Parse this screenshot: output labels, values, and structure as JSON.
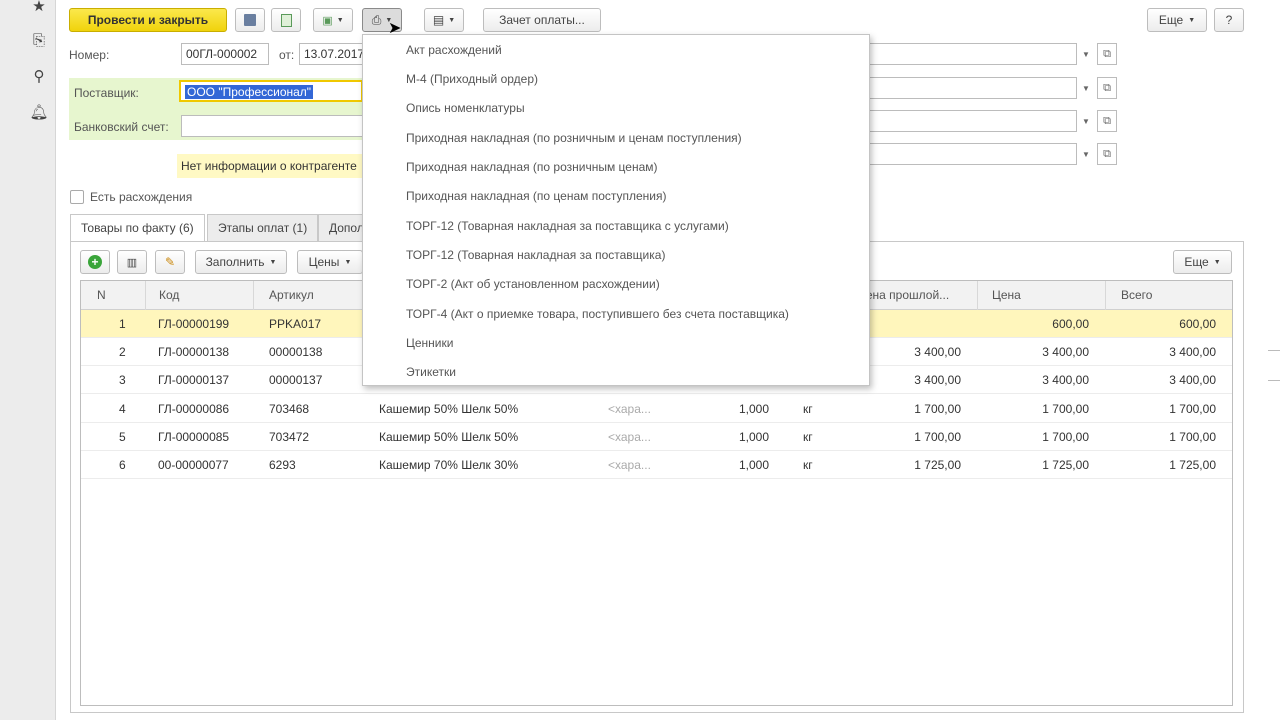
{
  "rail": {
    "star_icon": "star-icon",
    "doc_icon": "documents-icon",
    "search_icon": "search-icon",
    "bell_icon": "bell-icon"
  },
  "toolbar": {
    "post_close": "Провести и закрыть",
    "payment_offset": "Зачет оплаты...",
    "more": "Еще",
    "help": "?"
  },
  "form": {
    "number_label": "Номер:",
    "number_value": "00ГЛ-000002",
    "from_label": "от:",
    "date_value": "13.07.2017",
    "supplier_label": "Поставщик:",
    "supplier_value": "ООО \"Профессионал\"",
    "bank_label": "Банковский счет:",
    "bank_value": "",
    "info_text": "Нет информации о контрагенте",
    "discrepancy_label": "Есть расхождения"
  },
  "tabs": [
    {
      "label": "Товары по факту (6)"
    },
    {
      "label": "Этапы оплат (1)"
    },
    {
      "label": "Допол"
    }
  ],
  "grid_toolbar": {
    "fill": "Заполнить",
    "prices": "Цены",
    "more": "Еще"
  },
  "columns": {
    "n": "N",
    "code": "Код",
    "article": "Артикул",
    "prev_price": "Цена прошлой...",
    "price": "Цена",
    "total": "Всего"
  },
  "rows": [
    {
      "n": "1",
      "code": "ГЛ-00000199",
      "article": "PPKA017",
      "name": "",
      "char": "",
      "qty": "",
      "unit": "",
      "prev": "",
      "price": "600,00",
      "total": "600,00"
    },
    {
      "n": "2",
      "code": "ГЛ-00000138",
      "article": "00000138",
      "name": "",
      "char": "",
      "qty": "",
      "unit": "",
      "prev": "3 400,00",
      "price": "3 400,00",
      "total": "3 400,00"
    },
    {
      "n": "3",
      "code": "ГЛ-00000137",
      "article": "00000137",
      "name": "",
      "char": "",
      "qty": "",
      "unit": "",
      "prev": "3 400,00",
      "price": "3 400,00",
      "total": "3 400,00"
    },
    {
      "n": "4",
      "code": "ГЛ-00000086",
      "article": "703468",
      "name": "Кашемир 50% Шелк 50%",
      "char": "<хара...",
      "qty": "1,000",
      "unit": "кг",
      "prev": "1 700,00",
      "price": "1 700,00",
      "total": "1 700,00"
    },
    {
      "n": "5",
      "code": "ГЛ-00000085",
      "article": "703472",
      "name": "Кашемир 50% Шелк 50%",
      "char": "<хара...",
      "qty": "1,000",
      "unit": "кг",
      "prev": "1 700,00",
      "price": "1 700,00",
      "total": "1 700,00"
    },
    {
      "n": "6",
      "code": "00-00000077",
      "article": "6293",
      "name": "Кашемир 70% Шелк 30%",
      "char": "<хара...",
      "qty": "1,000",
      "unit": "кг",
      "prev": "1 725,00",
      "price": "1 725,00",
      "total": "1 725,00"
    }
  ],
  "print_menu": [
    "Акт расхождений",
    "М-4 (Приходный ордер)",
    "Опись номенклатуры",
    "Приходная накладная (по розничным и ценам поступления)",
    "Приходная накладная (по розничным ценам)",
    "Приходная накладная (по ценам поступления)",
    "ТОРГ-12 (Товарная накладная за поставщика с услугами)",
    "ТОРГ-12 (Товарная накладная за поставщика)",
    "ТОРГ-2 (Акт об установленном расхождении)",
    "ТОРГ-4 (Акт о приемке товара, поступившего без счета поставщика)",
    "Ценники",
    "Этикетки"
  ]
}
